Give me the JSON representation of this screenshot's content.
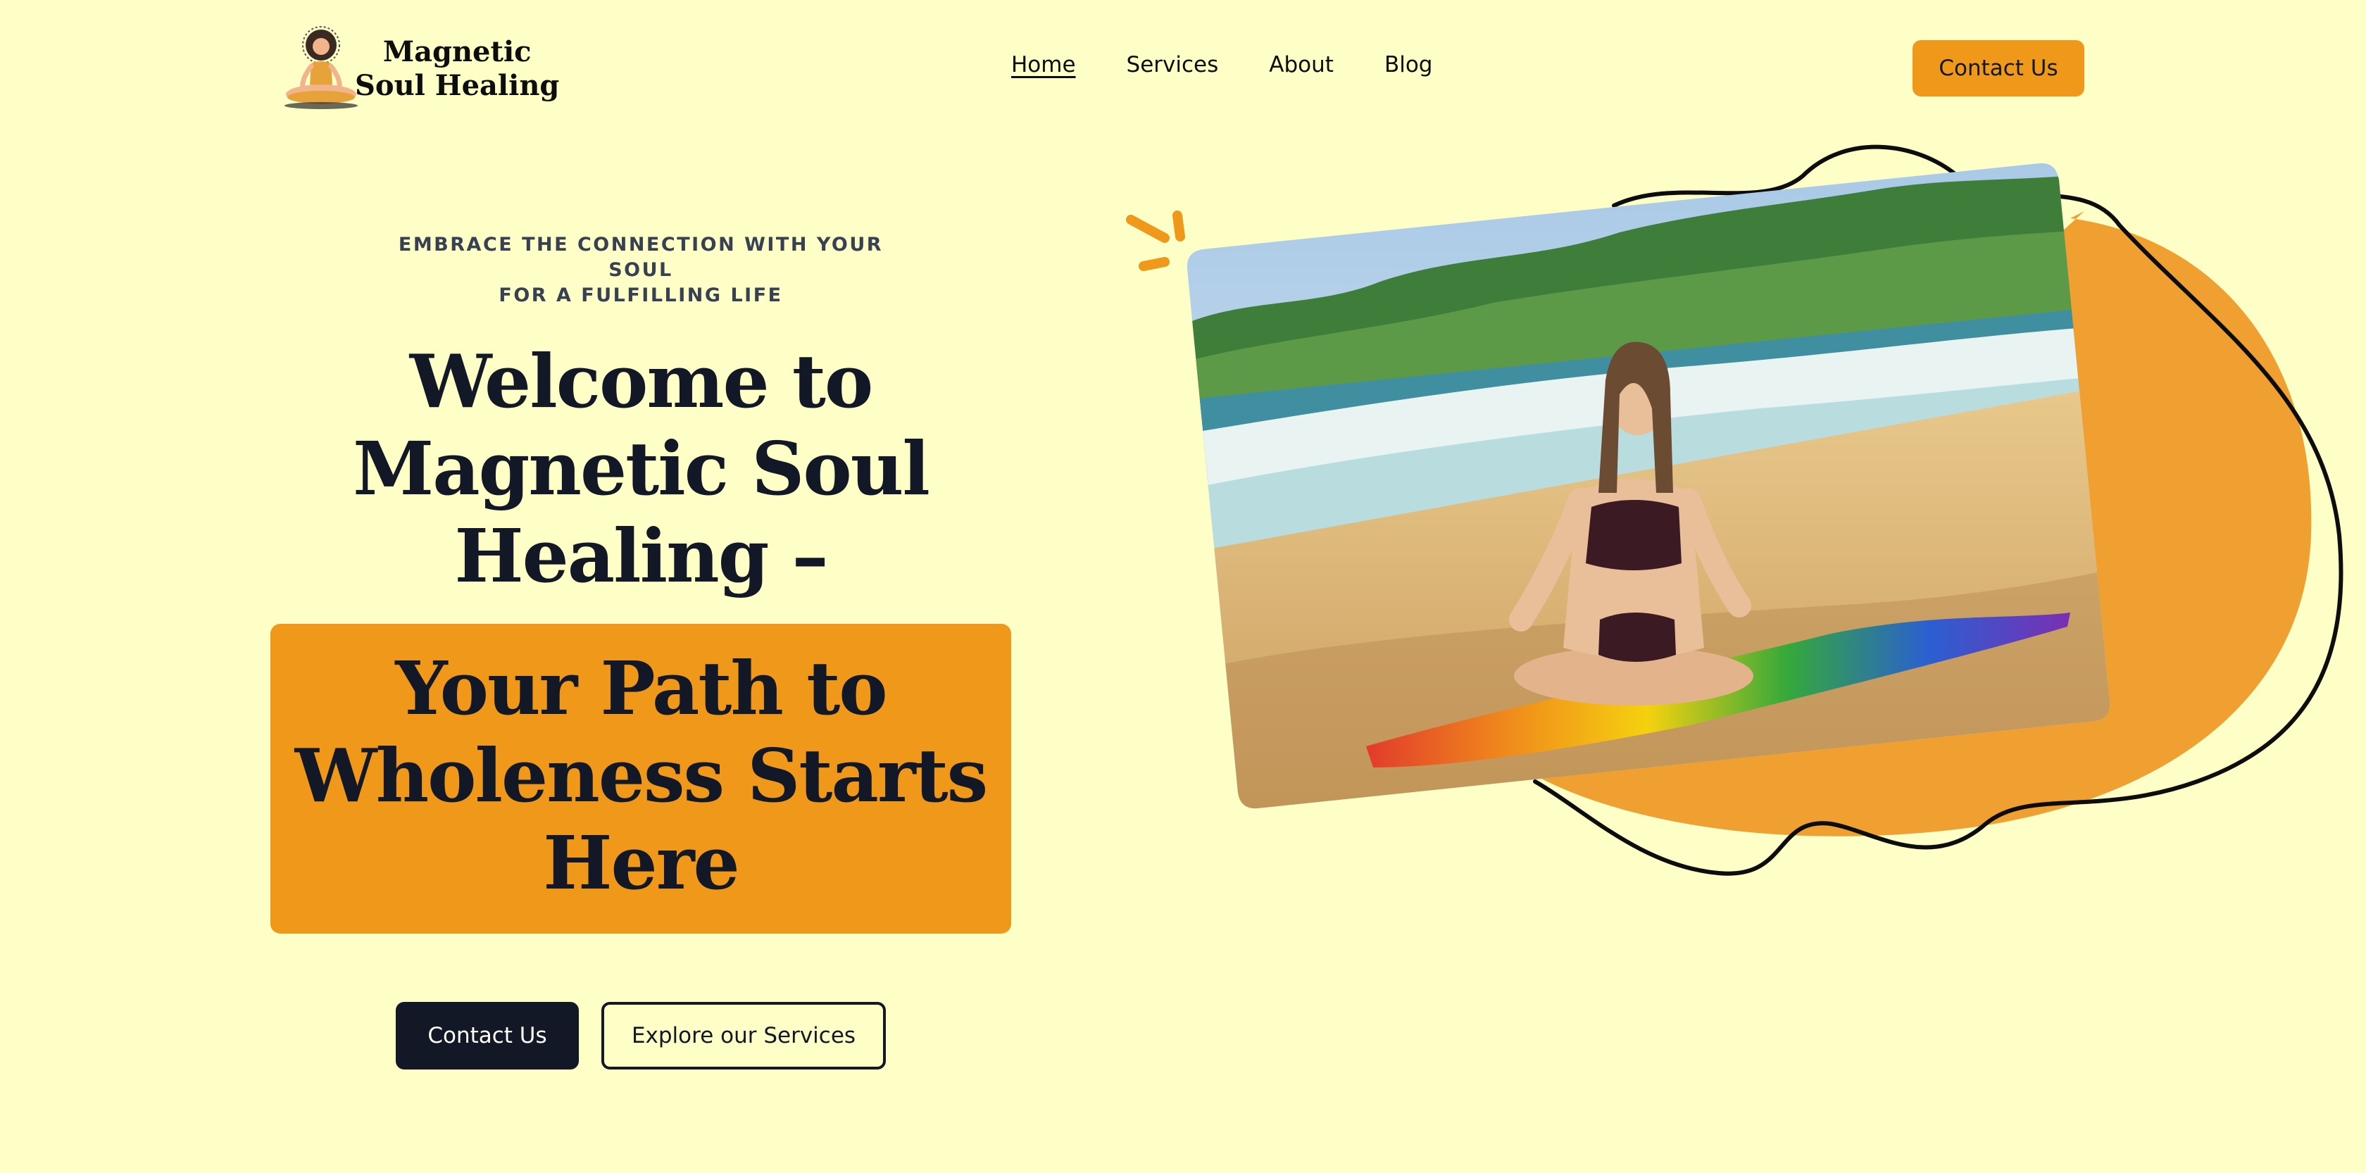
{
  "brand": {
    "line1": "Magnetic",
    "line2": "Soul Healing",
    "logo_icon": "meditating-woman-icon"
  },
  "nav": {
    "items": [
      {
        "label": "Home",
        "active": true
      },
      {
        "label": "Services",
        "active": false
      },
      {
        "label": "About",
        "active": false
      },
      {
        "label": "Blog",
        "active": false
      }
    ],
    "contact_label": "Contact Us"
  },
  "hero": {
    "eyebrow_line1": "EMBRACE THE CONNECTION WITH YOUR SOUL",
    "eyebrow_line2": "FOR A FULFILLING LIFE",
    "headline_line1": "Welcome to",
    "headline_line2": "Magnetic Soul",
    "headline_line3": "Healing –",
    "highlight_line1": "Your Path to",
    "highlight_line2": "Wholeness Starts",
    "highlight_line3": "Here",
    "primary_cta": "Contact Us",
    "secondary_cta": "Explore our Services",
    "image_icon": "beach-meditation-photo"
  },
  "colors": {
    "background": "#fefec7",
    "accent": "#f0981a",
    "dark": "#121826"
  }
}
